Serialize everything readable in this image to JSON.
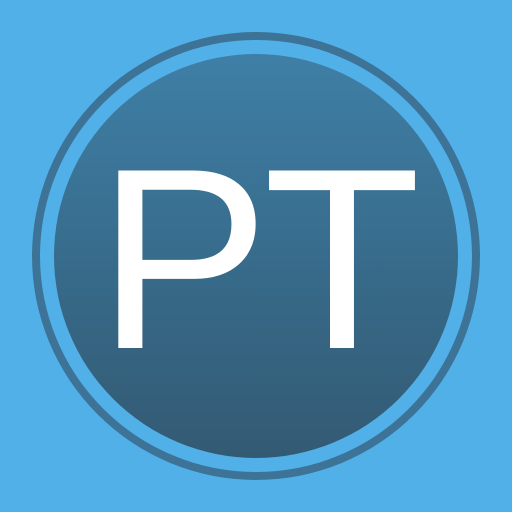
{
  "logo": {
    "monogram": "PT",
    "background_color": "#52b0e8",
    "ring_color": "#3d7396",
    "disc_color_top": "#3f7fa6",
    "disc_color_bottom": "#335a73",
    "text_color": "#ffffff"
  }
}
